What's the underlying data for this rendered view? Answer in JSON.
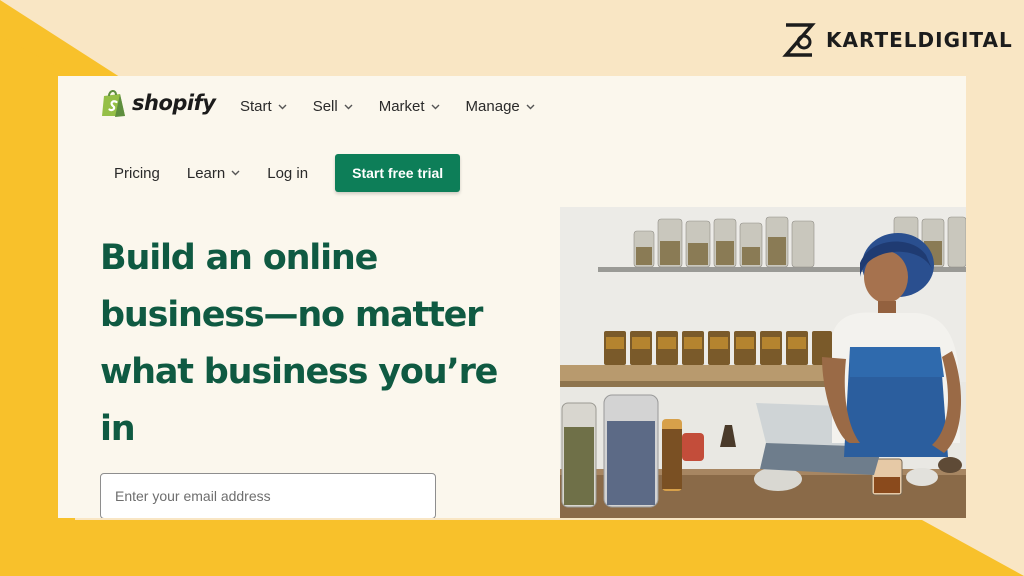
{
  "brand": {
    "name": "KARTELDIGITAL"
  },
  "shopify": {
    "logo_text": "shopify",
    "nav_primary": [
      {
        "label": "Start"
      },
      {
        "label": "Sell"
      },
      {
        "label": "Market"
      },
      {
        "label": "Manage"
      }
    ],
    "nav_secondary": {
      "pricing": "Pricing",
      "learn": "Learn",
      "login": "Log in",
      "cta": "Start free trial"
    },
    "headline": "Build an online business—no matter what business you’re in",
    "email_placeholder": "Enter your email address",
    "hero_image": "woman-working-on-tablet-with-spice-jars"
  },
  "colors": {
    "accent_green": "#0d7e58",
    "headline_green": "#0f5a42",
    "yellow": "#f8c12b",
    "cream": "#f9e6c4"
  }
}
